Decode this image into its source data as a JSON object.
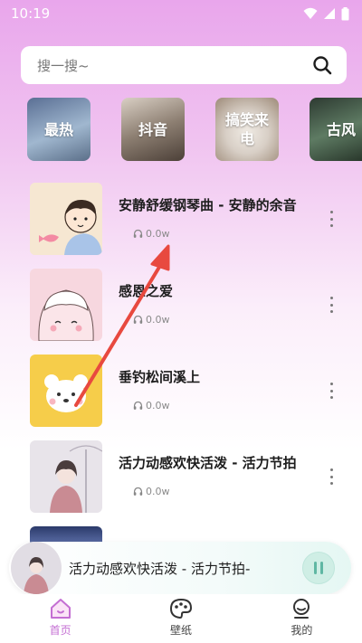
{
  "status_bar": {
    "time": "10:19"
  },
  "search": {
    "placeholder": "搜一搜~"
  },
  "categories": [
    {
      "label": "最热"
    },
    {
      "label": "抖音"
    },
    {
      "label": "搞笑来电"
    },
    {
      "label": "古风"
    }
  ],
  "songs": [
    {
      "title": "安静舒缓钢琴曲 - 安静的余音",
      "plays": "0.0w"
    },
    {
      "title": "感恩之爱",
      "plays": "0.0w"
    },
    {
      "title": "垂钓松间溪上",
      "plays": "0.0w"
    },
    {
      "title": "活力动感欢快活泼 - 活力节拍",
      "plays": "0.0w"
    }
  ],
  "player": {
    "now_playing": "活力动感欢快活泼 - 活力节拍-"
  },
  "tabs": [
    {
      "label": "首页",
      "icon": "home-icon",
      "active": true
    },
    {
      "label": "壁纸",
      "icon": "palette-icon",
      "active": false
    },
    {
      "label": "我的",
      "icon": "user-icon",
      "active": false
    }
  ],
  "colors": {
    "accent": "#c46fd3",
    "header_gradient_top": "#e9a6ec",
    "annotation_arrow": "#e8493f"
  }
}
